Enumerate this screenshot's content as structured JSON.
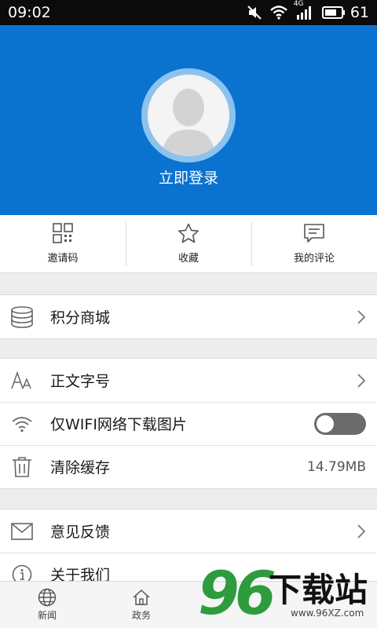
{
  "status_bar": {
    "time": "09:02",
    "network": "4G",
    "battery": "61"
  },
  "header": {
    "login_label": "立即登录"
  },
  "quick_actions": [
    {
      "label": "邀请码",
      "icon": "qr-code-icon"
    },
    {
      "label": "收藏",
      "icon": "star-icon"
    },
    {
      "label": "我的评论",
      "icon": "comment-icon"
    }
  ],
  "menu": {
    "points_mall": "积分商城",
    "font_size": "正文字号",
    "wifi_images": "仅WIFI网络下载图片",
    "wifi_toggle_on": false,
    "clear_cache": "清除缓存",
    "cache_size": "14.79MB",
    "feedback": "意见反馈",
    "about": "关于我们"
  },
  "tabs": [
    {
      "label": "新闻",
      "icon": "globe-icon"
    },
    {
      "label": "政务",
      "icon": "home-icon"
    }
  ],
  "watermark": {
    "number": "96",
    "text": "下载站",
    "url": "www.96XZ.com"
  },
  "colors": {
    "header_blue": "#0a73cf",
    "avatar_ring": "#8cc3ee",
    "toggle_off": "#6b6b6b",
    "watermark_green": "#2e9b3e"
  }
}
